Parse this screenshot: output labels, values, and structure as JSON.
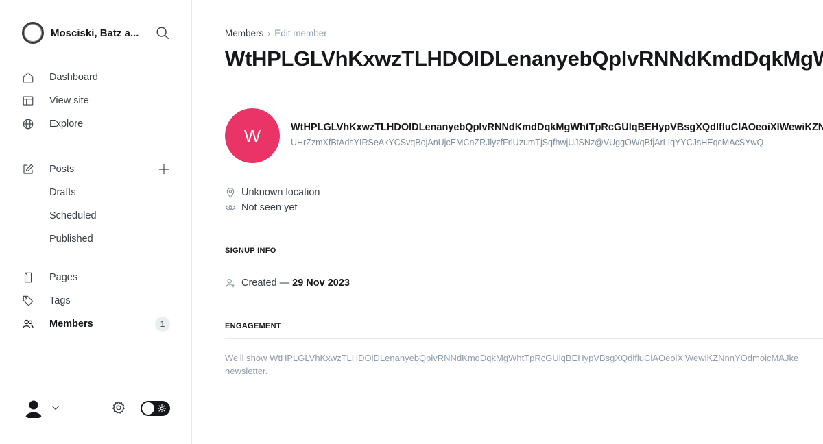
{
  "sidebar": {
    "site_title": "Mosciski, Batz a...",
    "nav": {
      "dashboard": "Dashboard",
      "view_site": "View site",
      "explore": "Explore",
      "posts": "Posts",
      "drafts": "Drafts",
      "scheduled": "Scheduled",
      "published": "Published",
      "pages": "Pages",
      "tags": "Tags",
      "members": "Members",
      "members_count": "1"
    }
  },
  "breadcrumb": {
    "parent": "Members",
    "separator": "›",
    "current": "Edit member"
  },
  "member": {
    "title": "WtHPLGLVhKxwzTLHDOlDLenanyebQplvRNNdKmdDqkMgWhtTpRcGUlqBEHypVBsgXQdlfluClAOeoiXlWewiKZNnnYOdmoicMAJke",
    "initial": "W",
    "name": "WtHPLGLVhKxwzTLHDOlDLenanyebQplvRNNdKmdDqkMgWhtTpRcGUlqBEHypVBsgXQdlfluClAOeoiXlWewiKZNnnYOdmoicMAJke",
    "email": "UHrZzmXfBtAdsYIRSeAkYCSvqBojAnUjcEMCnZRJlyzfFrlUzumTjSqfhwjUJSNz@VUggOWqBfjArLIqYYCJsHEqcMAcSYwQ",
    "location": "Unknown location",
    "last_seen": "Not seen yet",
    "avatar_color": "#ea3366"
  },
  "signup": {
    "heading": "SIGNUP INFO",
    "created_label": "Created —",
    "created_date": "29 Nov 2023"
  },
  "engagement": {
    "heading": "ENGAGEMENT",
    "text_line1": "We'll show WtHPLGLVhKxwzTLHDOlDLenanyebQplvRNNdKmdDqkMgWhtTpRcGUlqBEHypVBsgXQdlfluClAOeoiXlWewiKZNnnYOdmoicMAJke",
    "text_line2": "newsletter."
  },
  "colors": {
    "accent_avatar": "#ea3366",
    "toggle_bg": "#15171a"
  }
}
